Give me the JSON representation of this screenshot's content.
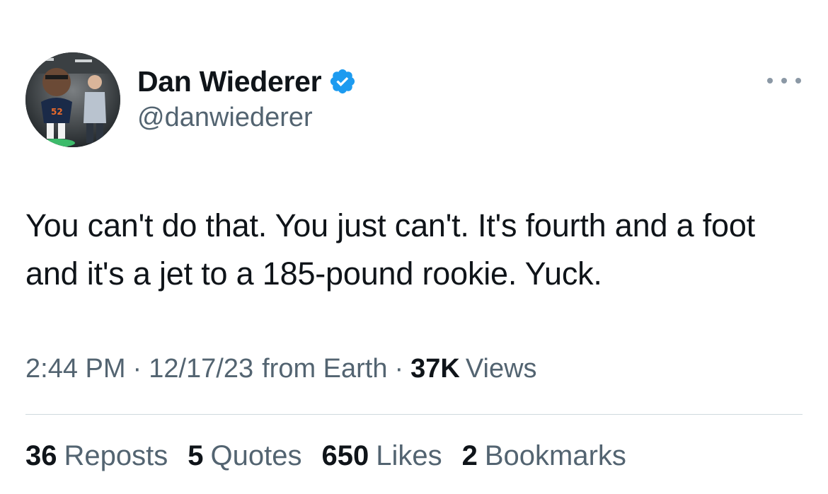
{
  "author": {
    "display_name": "Dan Wiederer",
    "handle": "@danwiederer",
    "verified": true,
    "verified_color": "#1d9bf0",
    "avatar_icon": "profile-photo-bobblehead-and-man"
  },
  "more_icon": "more-horizontal-icon",
  "tweet": {
    "text": "You can't do that. You just can't. It's fourth and a foot and it's a jet to a 185-pound rookie. Yuck."
  },
  "meta": {
    "time": "2:44 PM",
    "separator": "·",
    "date": "12/17/23",
    "source": "from Earth",
    "views_count": "37K",
    "views_label": "Views"
  },
  "stats": [
    {
      "count": "36",
      "label": "Reposts"
    },
    {
      "count": "5",
      "label": "Quotes"
    },
    {
      "count": "650",
      "label": "Likes"
    },
    {
      "count": "2",
      "label": "Bookmarks"
    }
  ],
  "colors": {
    "text_primary": "#0f1419",
    "text_secondary": "#536471",
    "divider": "#cfd9de"
  }
}
